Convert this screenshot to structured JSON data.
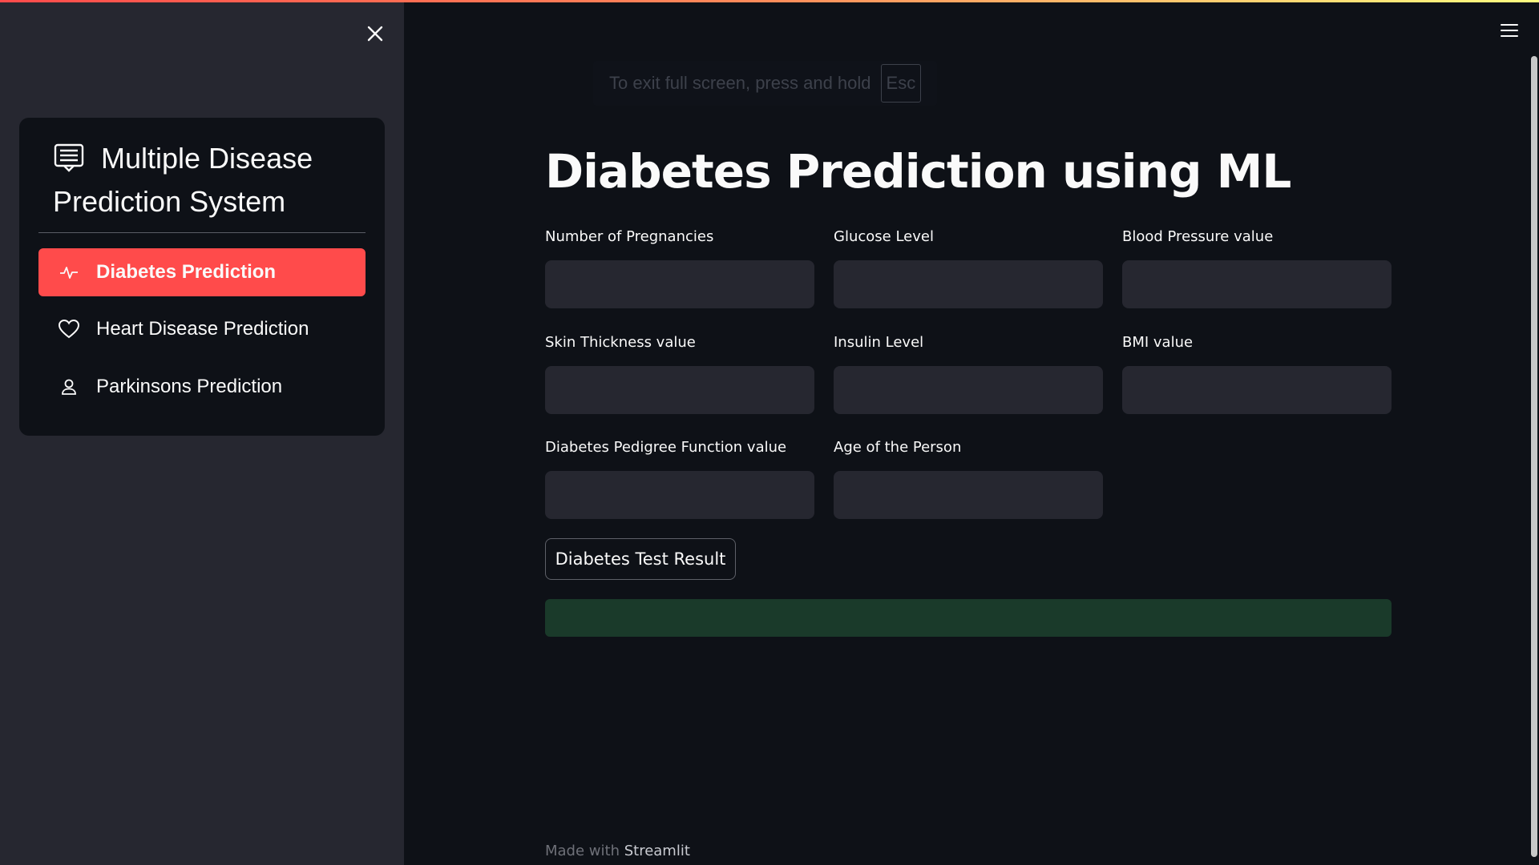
{
  "sidebar": {
    "title": "Multiple Disease Prediction System",
    "title_icon": "list-alt-icon",
    "close_icon": "close-icon",
    "items": [
      {
        "label": "Diabetes Prediction",
        "icon": "activity-icon",
        "active": true
      },
      {
        "label": "Heart Disease Prediction",
        "icon": "heart-icon",
        "active": false
      },
      {
        "label": "Parkinsons Prediction",
        "icon": "person-icon",
        "active": false
      }
    ]
  },
  "notice": {
    "text": "To exit full screen, press and hold",
    "key": "Esc"
  },
  "main": {
    "title": "Diabetes Prediction using ML",
    "fields": [
      {
        "label": "Number of Pregnancies",
        "value": ""
      },
      {
        "label": "Glucose Level",
        "value": ""
      },
      {
        "label": "Blood Pressure value",
        "value": ""
      },
      {
        "label": "Skin Thickness value",
        "value": ""
      },
      {
        "label": "Insulin Level",
        "value": ""
      },
      {
        "label": "BMI value",
        "value": ""
      },
      {
        "label": "Diabetes Pedigree Function value",
        "value": ""
      },
      {
        "label": "Age of the Person",
        "value": ""
      }
    ],
    "button_label": "Diabetes Test Result",
    "result_text": ""
  },
  "footer": {
    "prefix": "Made with",
    "brand": "Streamlit"
  },
  "colors": {
    "accent": "#ff4b4b",
    "background": "#0e1117",
    "sidebar": "#262730",
    "input": "#262730",
    "success": "#1a3a2a"
  }
}
